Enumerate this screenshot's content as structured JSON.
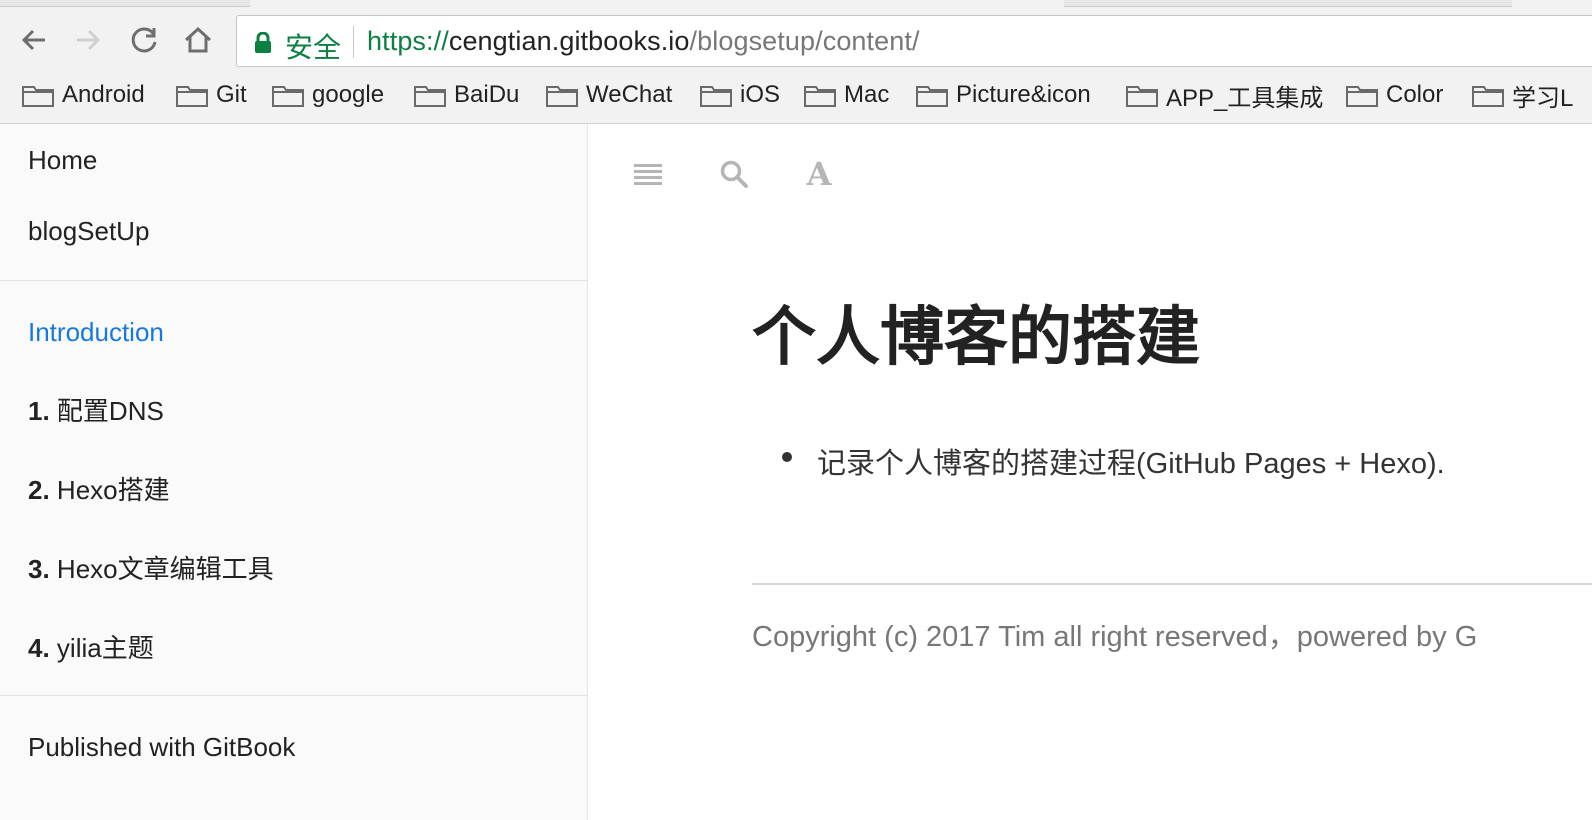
{
  "browser": {
    "nav": {
      "back_icon": "arrow-left-icon",
      "forward_icon": "arrow-right-icon",
      "reload_icon": "reload-icon",
      "home_icon": "home-icon"
    },
    "omnibox": {
      "secure_label": "安全",
      "url_scheme": "https://",
      "url_host": "cengtian.gitbooks.io",
      "url_path": "/blogsetup/content/"
    },
    "bookmarks": [
      {
        "label": "Android"
      },
      {
        "label": "Git"
      },
      {
        "label": "google"
      },
      {
        "label": "BaiDu"
      },
      {
        "label": "WeChat"
      },
      {
        "label": "iOS"
      },
      {
        "label": "Mac"
      },
      {
        "label": "Picture&icon"
      },
      {
        "label": "APP_工具集成"
      },
      {
        "label": "Color"
      },
      {
        "label": "学习L"
      }
    ]
  },
  "sidebar": {
    "top_links": [
      {
        "label": "Home"
      },
      {
        "label": "blogSetUp"
      }
    ],
    "intro": "Introduction",
    "chapters": [
      {
        "num": "1.",
        "label": "配置DNS"
      },
      {
        "num": "2.",
        "label": "Hexo搭建"
      },
      {
        "num": "3.",
        "label": "Hexo文章编辑工具"
      },
      {
        "num": "4.",
        "label": "yilia主题"
      }
    ],
    "footer": "Published with GitBook"
  },
  "toolbar": {
    "menu_icon": "menu-icon",
    "search_icon": "search-icon",
    "font_icon": "font-settings-icon",
    "font_glyph": "A"
  },
  "content": {
    "title": "个人博客的搭建",
    "bullets": [
      "记录个人博客的搭建过程(GitHub Pages + Hexo)."
    ],
    "copyright": "Copyright (c) 2017 Tim all right reserved，powered by G"
  },
  "colors": {
    "accent": "#1679e1",
    "secure_green": "#0b8043"
  }
}
